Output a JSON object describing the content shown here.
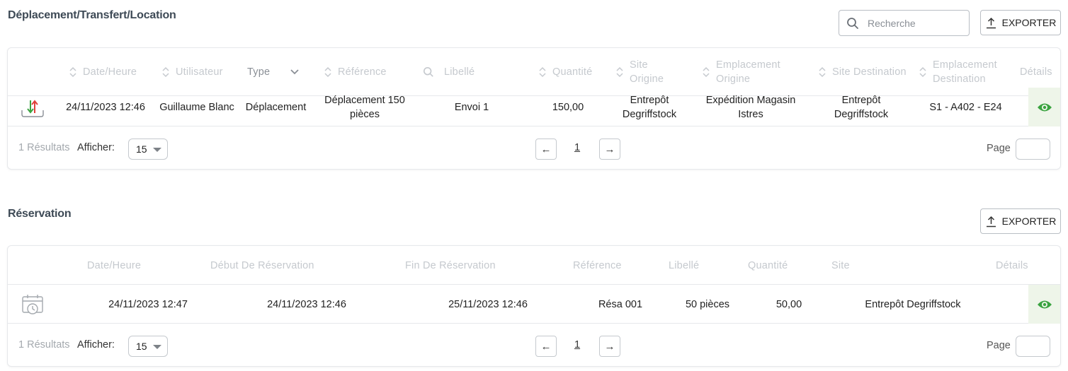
{
  "movements": {
    "title": "Déplacement/Transfert/Location",
    "search": {
      "placeholder": "Recherche",
      "value": ""
    },
    "export_label": "EXPORTER",
    "columns": {
      "date": "Date/Heure",
      "user": "Utilisateur",
      "type": "Type",
      "reference": "Référence",
      "label": "Libellé",
      "quantity": "Quantité",
      "site_origin": "Site Origine",
      "location_origin": "Emplacement Origine",
      "site_destination": "Site Destination",
      "location_destination": "Emplacement Destination",
      "details": "Détails"
    },
    "rows": [
      {
        "date": "24/11/2023 12:46",
        "user": "Guillaume Blanc",
        "type": "Déplacement",
        "reference": "Déplacement 150 pièces",
        "label": "Envoi 1",
        "quantity": "150,00",
        "site_origin": "Entrepôt Degriffstock",
        "location_origin": "Expédition Magasin Istres",
        "site_destination": "Entrepôt Degriffstock",
        "location_destination": "S1 - A402 - E24"
      }
    ],
    "footer": {
      "results": "1 Résultats",
      "show_label": "Afficher:",
      "per_page": "15",
      "prev": "←",
      "current_page": "1",
      "next": "→",
      "page_label": "Page"
    }
  },
  "reservations": {
    "title": "Réservation",
    "export_label": "EXPORTER",
    "columns": {
      "date": "Date/Heure",
      "start": "Début De Réservation",
      "end": "Fin De Réservation",
      "reference": "Référence",
      "label": "Libellé",
      "quantity": "Quantité",
      "site": "Site",
      "details": "Détails"
    },
    "rows": [
      {
        "date": "24/11/2023 12:47",
        "start": "24/11/2023 12:46",
        "end": "25/11/2023 12:46",
        "reference": "Résa 001",
        "label": "50 pièces",
        "quantity": "50,00",
        "site": "Entrepôt Degriffstock"
      }
    ],
    "footer": {
      "results": "1 Résultats",
      "show_label": "Afficher:",
      "per_page": "15",
      "prev": "←",
      "current_page": "1",
      "next": "→",
      "page_label": "Page"
    }
  },
  "icons": {
    "search": "search-icon",
    "export": "upload-icon",
    "sort": "sort-icon",
    "chevron": "chevron-down-icon",
    "transfer": "transfer-arrows-icon",
    "calendar": "calendar-clock-icon",
    "view": "eye-icon"
  },
  "colors": {
    "accent_green": "#3aa340",
    "transfer_red": "#e0413b",
    "details_bg": "#eef5e9"
  }
}
